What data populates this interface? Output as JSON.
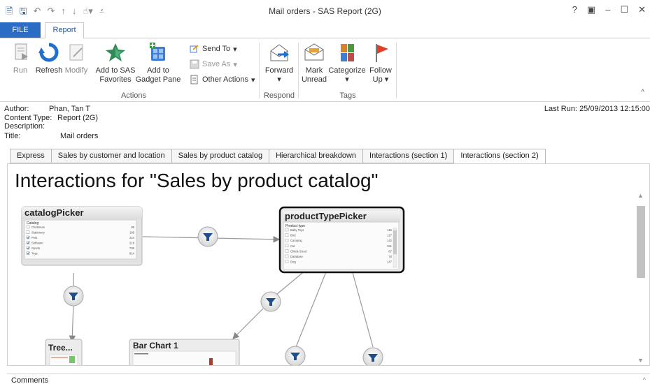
{
  "window": {
    "title": "Mail orders - SAS Report (2G)",
    "controls": {
      "help": "?",
      "restore": "▣",
      "minimize": "–",
      "maximize": "☐",
      "close": "✕"
    }
  },
  "qat": {
    "items": [
      "SAS-icon",
      "save-icon",
      "undo-icon",
      "redo-icon",
      "up-icon",
      "down-icon",
      "touch-icon",
      "more-icon"
    ]
  },
  "tabs": {
    "file": "FILE",
    "report": "Report"
  },
  "ribbon": {
    "run": "Run",
    "refresh": "Refresh",
    "modify": "Modify",
    "add_fav_1": "Add to SAS",
    "add_fav_2": "Favorites",
    "add_gadget_1": "Add to",
    "add_gadget_2": "Gadget Pane",
    "send_to": "Send To",
    "save_as": "Save As",
    "other_actions": "Other Actions",
    "actions_group": "Actions",
    "forward": "Forward",
    "respond_group": "Respond",
    "mark_1": "Mark",
    "mark_2": "Unread",
    "categorize": "Categorize",
    "follow_1": "Follow",
    "follow_2": "Up",
    "tags_group": "Tags",
    "dropdown_arrow": "▾",
    "collapse": "^"
  },
  "meta": {
    "author_label": "Author:",
    "author": "Phan, Tan T",
    "content_type_label": "Content Type:",
    "content_type": "Report (2G)",
    "description_label": "Description:",
    "description": "",
    "title_label": "Title:",
    "title": "Mail orders",
    "last_run_label": "Last Run:",
    "last_run": "25/09/2013 12:15:00"
  },
  "section_tabs": [
    "Express",
    "Sales by customer and location",
    "Sales by product catalog",
    "Hierarchical breakdown",
    "Interactions (section 1)",
    "Interactions (section 2)"
  ],
  "active_section_tab": 5,
  "content": {
    "heading": "Interactions for \"Sales by product catalog\"",
    "nodes": {
      "catalog_picker": {
        "title": "catalogPicker",
        "header": "Catalog",
        "items": [
          {
            "name": "Christmas",
            "value": "88",
            "checked": false
          },
          {
            "name": "Stationery",
            "value": "168",
            "checked": false
          },
          {
            "name": "Pets",
            "value": "224",
            "checked": true
          },
          {
            "name": "Software",
            "value": "218",
            "checked": true
          },
          {
            "name": "Sports",
            "value": "706",
            "checked": true
          },
          {
            "name": "Toys",
            "value": "814",
            "checked": true
          }
        ]
      },
      "product_type_picker": {
        "title": "productTypePicker",
        "header": "Product type",
        "items": [
          {
            "name": "Baby Toys",
            "value": "116"
          },
          {
            "name": "Bird",
            "value": "127"
          },
          {
            "name": "Camping",
            "value": "142"
          },
          {
            "name": "Cat",
            "value": "151"
          },
          {
            "name": "Childs Sized",
            "value": "87"
          },
          {
            "name": "Database",
            "value": "78"
          },
          {
            "name": "Dog",
            "value": "147"
          }
        ]
      },
      "tree": {
        "title": "Tree..."
      },
      "bar_chart": {
        "title": "Bar Chart 1"
      }
    },
    "filter_icon": "filter-funnel-icon"
  },
  "comments": {
    "label": "Comments",
    "caret": "^"
  },
  "colors": {
    "file_tab": "#2b6cc4",
    "accent_blue": "#2b5797",
    "selected_node_border": "#111111",
    "bar_red": "#b03a2e"
  }
}
